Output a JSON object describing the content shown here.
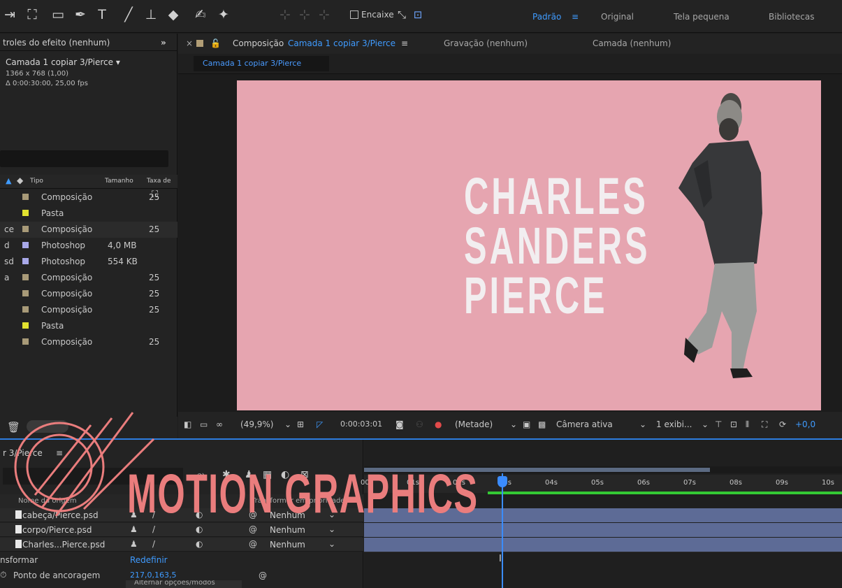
{
  "toolbar": {
    "encaixe_label": "Encaixe",
    "workspaces": [
      "Padrão",
      "Original",
      "Tela pequena",
      "Bibliotecas"
    ],
    "workspace_menu_icon": "≡"
  },
  "project_panel": {
    "tab_label": "troles do efeito (nenhum)",
    "expand_icon": "»",
    "comp_name": "Camada 1 copiar 3/Pierce ▾",
    "comp_size": "1366 x 768 (1,00)",
    "comp_duration": "Δ 0:00:30:00, 25,00 fps",
    "columns": {
      "tipo": "Tipo",
      "tamanho": "Tamanho",
      "taxa": "Taxa de"
    },
    "items": [
      {
        "prefix": "",
        "name": "Composição",
        "size": "",
        "fps": "25",
        "color": "#a89a78"
      },
      {
        "prefix": "",
        "name": "Pasta",
        "size": "",
        "fps": "",
        "color": "#e1e12f"
      },
      {
        "prefix": "ce",
        "name": "Composição",
        "size": "",
        "fps": "25",
        "color": "#a89a78"
      },
      {
        "prefix": "d",
        "name": "Photoshop",
        "size": "4,0 MB",
        "fps": "",
        "color": "#a8a8e8"
      },
      {
        "prefix": "sd",
        "name": "Photoshop",
        "size": "554 KB",
        "fps": "",
        "color": "#a8a8e8"
      },
      {
        "prefix": "a",
        "name": "Composição",
        "size": "",
        "fps": "25",
        "color": "#a89a78"
      },
      {
        "prefix": "",
        "name": "Composição",
        "size": "",
        "fps": "25",
        "color": "#a89a78"
      },
      {
        "prefix": "",
        "name": "Composição",
        "size": "",
        "fps": "25",
        "color": "#a89a78"
      },
      {
        "prefix": "",
        "name": "Pasta",
        "size": "",
        "fps": "",
        "color": "#e1e12f"
      },
      {
        "prefix": "",
        "name": "Composição",
        "size": "",
        "fps": "25",
        "color": "#a89a78"
      }
    ]
  },
  "viewer": {
    "close": "×",
    "comp_tab_prefix": "Composição",
    "comp_tab_name": "Camada 1 copiar 3/Pierce",
    "gravacao_tab": "Gravação (nenhum)",
    "camada_tab": "Camada (nenhum)",
    "breadcrumb": "Camada 1 copiar 3/Pierce",
    "title_lines": [
      "CHARLES",
      "SANDERS",
      "PIERCE"
    ],
    "zoom": "(49,9%)",
    "timecode": "0:00:03:01",
    "resolution": "(Metade)",
    "camera": "Câmera ativa",
    "views": "1 exibi...",
    "exposure": "+0,0"
  },
  "timeline": {
    "tab_label": "r 3/Pierce",
    "col_source": "Nome da origem",
    "col_transform": "Transformar em prioridade",
    "layers": [
      {
        "name": "cabeça/Pierce.psd",
        "parent": "Nenhum"
      },
      {
        "name": "corpo/Pierce.psd",
        "parent": "Nenhum"
      },
      {
        "name": "Charles...Pierce.psd",
        "parent": "Nenhum"
      }
    ],
    "transform_label": "nsformar",
    "reset_label": "Redefinir",
    "anchor_label": "Ponto de ancoragem",
    "anchor_value": "217,0,163,5",
    "toggle_label": "Alternar opções/modos",
    "ticks": [
      "00s",
      "01s",
      "02s",
      "03s",
      "04s",
      "05s",
      "06s",
      "07s",
      "08s",
      "09s",
      "10s"
    ]
  },
  "overlay": {
    "motion_graphics": "MOTION GRAPHICS"
  },
  "colors": {
    "accent": "#2d7de0",
    "canvas": "#e6a5b0",
    "overlay": "#ea7d7d",
    "layer_bar": "#5d6b96"
  }
}
